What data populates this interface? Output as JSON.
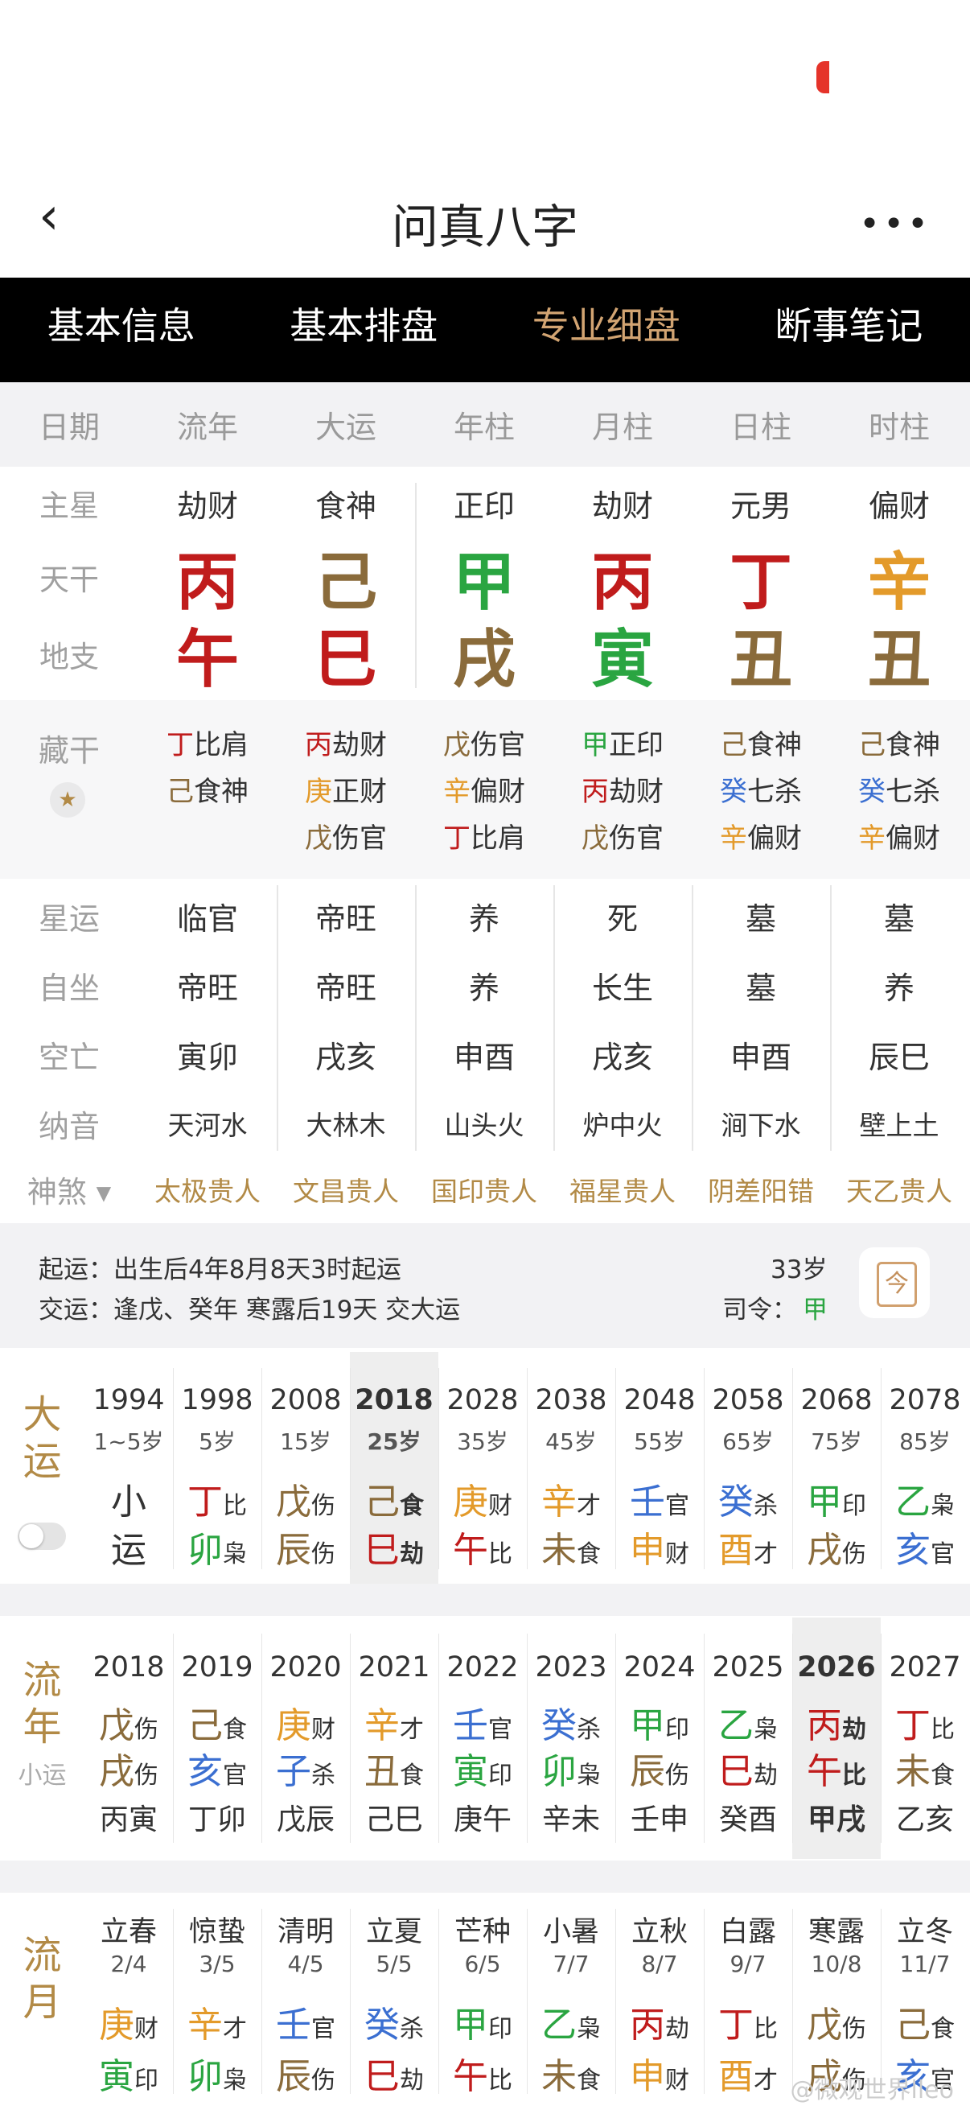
{
  "colors": {
    "fire": "#c01c1c",
    "earth": "#8a6b3b",
    "wood": "#2aa541",
    "metal": "#e39a2a",
    "water": "#3b6fd1",
    "gold": "#b28a46"
  },
  "nav": {
    "back": "‹",
    "title": "问真八字",
    "more": "•••"
  },
  "tabs": [
    {
      "label": "基本信息"
    },
    {
      "label": "基本排盘"
    },
    {
      "label": "专业细盘"
    },
    {
      "label": "断事笔记"
    }
  ],
  "header": [
    "日期",
    "流年",
    "大运",
    "年柱",
    "月柱",
    "日柱",
    "时柱"
  ],
  "zhuxing": {
    "label": "主星",
    "vals": [
      "劫财",
      "食神",
      "正印",
      "劫财",
      "元男",
      "偏财"
    ]
  },
  "tiangan": {
    "label": "天干",
    "vals": [
      {
        "ch": "丙",
        "c": "fire"
      },
      {
        "ch": "己",
        "c": "earth"
      },
      {
        "ch": "甲",
        "c": "wood"
      },
      {
        "ch": "丙",
        "c": "fire"
      },
      {
        "ch": "丁",
        "c": "fire"
      },
      {
        "ch": "辛",
        "c": "metal"
      }
    ]
  },
  "dizhi": {
    "label": "地支",
    "vals": [
      {
        "ch": "午",
        "c": "fire"
      },
      {
        "ch": "巳",
        "c": "fire"
      },
      {
        "ch": "戌",
        "c": "earth"
      },
      {
        "ch": "寅",
        "c": "wood"
      },
      {
        "ch": "丑",
        "c": "earth"
      },
      {
        "ch": "丑",
        "c": "earth"
      }
    ]
  },
  "canggan": {
    "label": "藏干",
    "pin": "★",
    "cols": [
      [
        [
          "丁",
          "fire",
          "比肩"
        ],
        [
          "己",
          "earth",
          "食神"
        ]
      ],
      [
        [
          "丙",
          "fire",
          "劫财"
        ],
        [
          "庚",
          "metal",
          "正财"
        ],
        [
          "戊",
          "earth",
          "伤官"
        ]
      ],
      [
        [
          "戊",
          "earth",
          "伤官"
        ],
        [
          "辛",
          "metal",
          "偏财"
        ],
        [
          "丁",
          "fire",
          "比肩"
        ]
      ],
      [
        [
          "甲",
          "wood",
          "正印"
        ],
        [
          "丙",
          "fire",
          "劫财"
        ],
        [
          "戊",
          "earth",
          "伤官"
        ]
      ],
      [
        [
          "己",
          "earth",
          "食神"
        ],
        [
          "癸",
          "water",
          "七杀"
        ],
        [
          "辛",
          "metal",
          "偏财"
        ]
      ],
      [
        [
          "己",
          "earth",
          "食神"
        ],
        [
          "癸",
          "water",
          "七杀"
        ],
        [
          "辛",
          "metal",
          "偏财"
        ]
      ]
    ]
  },
  "rows2": [
    {
      "label": "星运",
      "vals": [
        "临官",
        "帝旺",
        "养",
        "死",
        "墓",
        "墓"
      ]
    },
    {
      "label": "自坐",
      "vals": [
        "帝旺",
        "帝旺",
        "养",
        "长生",
        "墓",
        "养"
      ]
    },
    {
      "label": "空亡",
      "vals": [
        "寅卯",
        "戌亥",
        "申酉",
        "戌亥",
        "申酉",
        "辰巳"
      ]
    },
    {
      "label": "纳音",
      "vals": [
        "天河水",
        "大林木",
        "山头火",
        "炉中火",
        "涧下水",
        "壁上土"
      ]
    }
  ],
  "shensha": {
    "label": "神煞 ▾",
    "vals": [
      "太极贵人",
      "文昌贵人",
      "国印贵人",
      "福星贵人",
      "阴差阳错",
      "天乙贵人"
    ]
  },
  "info": {
    "line1": "起运：出生后4年8月8天3时起运",
    "line2": "交运：逢戊、癸年 寒露后19天 交大运",
    "age": "33岁",
    "siling_label": "司令：",
    "siling": "甲",
    "cal": "今"
  },
  "dayun": {
    "label": [
      "大",
      "运"
    ],
    "cols": [
      {
        "y": "1994",
        "a": "1~5岁",
        "g1": [
          "小",
          "",
          ""
        ],
        "g2": [
          "运",
          "",
          ""
        ]
      },
      {
        "y": "1998",
        "a": "5岁",
        "g1": [
          "丁",
          "fire",
          "比"
        ],
        "g2": [
          "卯",
          "wood",
          "枭"
        ]
      },
      {
        "y": "2008",
        "a": "15岁",
        "g1": [
          "戊",
          "earth",
          "伤"
        ],
        "g2": [
          "辰",
          "earth",
          "伤"
        ]
      },
      {
        "y": "2018",
        "a": "25岁",
        "g1": [
          "己",
          "earth",
          "食"
        ],
        "g2": [
          "巳",
          "fire",
          "劫"
        ],
        "hl": true
      },
      {
        "y": "2028",
        "a": "35岁",
        "g1": [
          "庚",
          "metal",
          "财"
        ],
        "g2": [
          "午",
          "fire",
          "比"
        ]
      },
      {
        "y": "2038",
        "a": "45岁",
        "g1": [
          "辛",
          "metal",
          "才"
        ],
        "g2": [
          "未",
          "earth",
          "食"
        ]
      },
      {
        "y": "2048",
        "a": "55岁",
        "g1": [
          "壬",
          "water",
          "官"
        ],
        "g2": [
          "申",
          "metal",
          "财"
        ]
      },
      {
        "y": "2058",
        "a": "65岁",
        "g1": [
          "癸",
          "water",
          "杀"
        ],
        "g2": [
          "酉",
          "metal",
          "才"
        ]
      },
      {
        "y": "2068",
        "a": "75岁",
        "g1": [
          "甲",
          "wood",
          "印"
        ],
        "g2": [
          "戌",
          "earth",
          "伤"
        ]
      },
      {
        "y": "2078",
        "a": "85岁",
        "g1": [
          "乙",
          "wood",
          "枭"
        ],
        "g2": [
          "亥",
          "water",
          "官"
        ]
      }
    ]
  },
  "liunian": {
    "label": [
      "流",
      "年"
    ],
    "sub": "小运",
    "cols": [
      {
        "y": "2018",
        "g1": [
          "戊",
          "earth",
          "伤"
        ],
        "g2": [
          "戌",
          "earth",
          "伤"
        ],
        "x": "丙寅"
      },
      {
        "y": "2019",
        "g1": [
          "己",
          "earth",
          "食"
        ],
        "g2": [
          "亥",
          "water",
          "官"
        ],
        "x": "丁卯"
      },
      {
        "y": "2020",
        "g1": [
          "庚",
          "metal",
          "财"
        ],
        "g2": [
          "子",
          "water",
          "杀"
        ],
        "x": "戊辰"
      },
      {
        "y": "2021",
        "g1": [
          "辛",
          "metal",
          "才"
        ],
        "g2": [
          "丑",
          "earth",
          "食"
        ],
        "x": "己巳"
      },
      {
        "y": "2022",
        "g1": [
          "壬",
          "water",
          "官"
        ],
        "g2": [
          "寅",
          "wood",
          "印"
        ],
        "x": "庚午"
      },
      {
        "y": "2023",
        "g1": [
          "癸",
          "water",
          "杀"
        ],
        "g2": [
          "卯",
          "wood",
          "枭"
        ],
        "x": "辛未"
      },
      {
        "y": "2024",
        "g1": [
          "甲",
          "wood",
          "印"
        ],
        "g2": [
          "辰",
          "earth",
          "伤"
        ],
        "x": "壬申"
      },
      {
        "y": "2025",
        "g1": [
          "乙",
          "wood",
          "枭"
        ],
        "g2": [
          "巳",
          "fire",
          "劫"
        ],
        "x": "癸酉"
      },
      {
        "y": "2026",
        "g1": [
          "丙",
          "fire",
          "劫"
        ],
        "g2": [
          "午",
          "fire",
          "比"
        ],
        "x": "甲戌",
        "hl": true
      },
      {
        "y": "2027",
        "g1": [
          "丁",
          "fire",
          "比"
        ],
        "g2": [
          "未",
          "earth",
          "食"
        ],
        "x": "乙亥"
      }
    ]
  },
  "liuyue": {
    "label": [
      "流",
      "月"
    ],
    "cols": [
      {
        "t": "立春",
        "d": "2/4",
        "g1": [
          "庚",
          "metal",
          "财"
        ],
        "g2": [
          "寅",
          "wood",
          "印"
        ]
      },
      {
        "t": "惊蛰",
        "d": "3/5",
        "g1": [
          "辛",
          "metal",
          "才"
        ],
        "g2": [
          "卯",
          "wood",
          "枭"
        ]
      },
      {
        "t": "清明",
        "d": "4/5",
        "g1": [
          "壬",
          "water",
          "官"
        ],
        "g2": [
          "辰",
          "earth",
          "伤"
        ]
      },
      {
        "t": "立夏",
        "d": "5/5",
        "g1": [
          "癸",
          "water",
          "杀"
        ],
        "g2": [
          "巳",
          "fire",
          "劫"
        ]
      },
      {
        "t": "芒种",
        "d": "6/5",
        "g1": [
          "甲",
          "wood",
          "印"
        ],
        "g2": [
          "午",
          "fire",
          "比"
        ]
      },
      {
        "t": "小暑",
        "d": "7/7",
        "g1": [
          "乙",
          "wood",
          "枭"
        ],
        "g2": [
          "未",
          "earth",
          "食"
        ]
      },
      {
        "t": "立秋",
        "d": "8/7",
        "g1": [
          "丙",
          "fire",
          "劫"
        ],
        "g2": [
          "申",
          "metal",
          "财"
        ]
      },
      {
        "t": "白露",
        "d": "9/7",
        "g1": [
          "丁",
          "fire",
          "比"
        ],
        "g2": [
          "酉",
          "metal",
          "才"
        ]
      },
      {
        "t": "寒露",
        "d": "10/8",
        "g1": [
          "戊",
          "earth",
          "伤"
        ],
        "g2": [
          "戌",
          "earth",
          "伤"
        ]
      },
      {
        "t": "立冬",
        "d": "11/7",
        "g1": [
          "己",
          "earth",
          "食"
        ],
        "g2": [
          "亥",
          "water",
          "官"
        ]
      }
    ]
  },
  "watermark": "@微观世界lleo"
}
